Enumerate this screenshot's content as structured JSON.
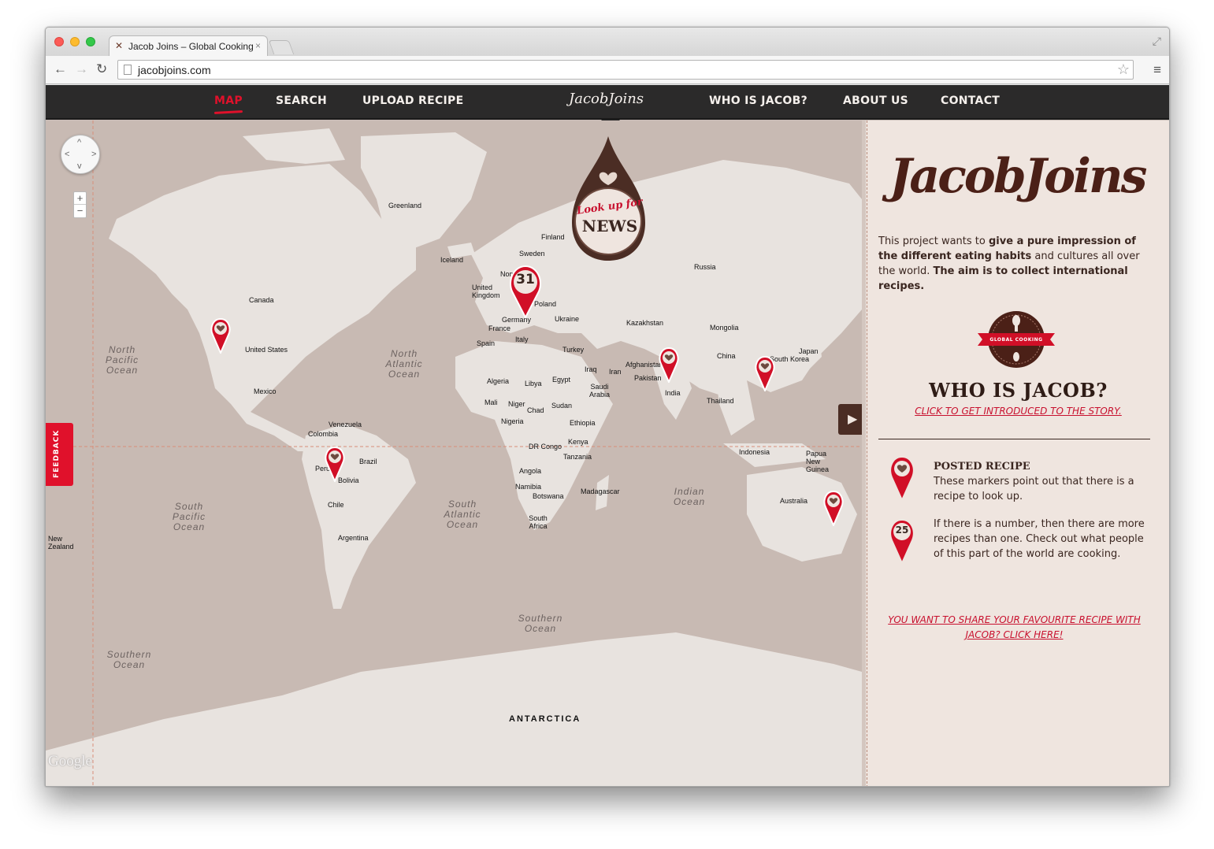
{
  "browser": {
    "tab_title": "Jacob Joins – Global Cooking",
    "tab_close": "×",
    "url": "jacobjoins.com",
    "back": "←",
    "forward": "→",
    "reload": "↻",
    "star": "☆",
    "menu": "≡",
    "fullscreen": "⤢"
  },
  "nav": {
    "items": [
      {
        "label": "MAP",
        "active": true
      },
      {
        "label": "SEARCH",
        "active": false
      },
      {
        "label": "UPLOAD RECIPE",
        "active": false
      },
      {
        "label": "WHO IS JACOB?",
        "active": false
      },
      {
        "label": "ABOUT US",
        "active": false
      },
      {
        "label": "CONTACT",
        "active": false
      }
    ],
    "logo": "JacobJoins"
  },
  "news_drop": {
    "line1": "Look up for",
    "line2": "NEWS"
  },
  "map": {
    "labels": [
      "Greenland",
      "Iceland",
      "Finland",
      "Sweden",
      "Russia",
      "Canada",
      "United Kingdom",
      "Norway",
      "Poland",
      "Germany",
      "Ukraine",
      "France",
      "Italy",
      "Spain",
      "Kazakhstan",
      "Mongolia",
      "Turkey",
      "United States",
      "Japan",
      "South Korea",
      "China",
      "Afghanistan",
      "Iraq",
      "Iran",
      "Pakistan",
      "India",
      "Algeria",
      "Libya",
      "Egypt",
      "Saudi Arabia",
      "Mexico",
      "Thailand",
      "Mali",
      "Niger",
      "Chad",
      "Sudan",
      "Nigeria",
      "Ethiopia",
      "Venezuela",
      "Colombia",
      "DR Congo",
      "Kenya",
      "Tanzania",
      "Indonesia",
      "Papua New Guinea",
      "Brazil",
      "Peru",
      "Bolivia",
      "Angola",
      "Namibia",
      "Botswana",
      "Madagascar",
      "Australia",
      "Chile",
      "South Africa",
      "Argentina",
      "New Zealand"
    ],
    "oceans": [
      "North Pacific Ocean",
      "North Atlantic Ocean",
      "South Pacific Ocean",
      "South Atlantic Ocean",
      "Indian Ocean",
      "Southern Ocean",
      "Southern Ocean"
    ],
    "antarctica": "ANTARCTICA",
    "google": "Google",
    "zoom_in": "+",
    "zoom_out": "−",
    "cluster_count": "31",
    "feedback": "FEEDBACK",
    "collapse_arrow": "▶"
  },
  "sidebar": {
    "logo": "JacobJoins",
    "intro_1": "This project wants to ",
    "intro_2": "give a pure impression of the different eating habits",
    "intro_3": " and cultures all over the world. ",
    "intro_4": "The aim is to collect international recipes.",
    "badge": "GLOBAL COOKING",
    "who_title": "WHO IS JACOB?",
    "who_link": "CLICK TO GET INTRODUCED TO THE STORY.",
    "legend_posted_title": "POSTED RECIPE",
    "legend_posted_text": "These markers point out that there is a recipe to look up.",
    "legend_count": "25",
    "legend_count_text": "If there is a number, then there are more recipes than one. Check out what people of this part of the world are cooking.",
    "share_link": "YOU WANT TO SHARE YOUR FAVOURITE RECIPE WITH JACOB? CLICK HERE!"
  },
  "colors": {
    "accent_red": "#e0112b",
    "dark_brown": "#3a2620",
    "nav_bg": "#2b2a2a"
  }
}
